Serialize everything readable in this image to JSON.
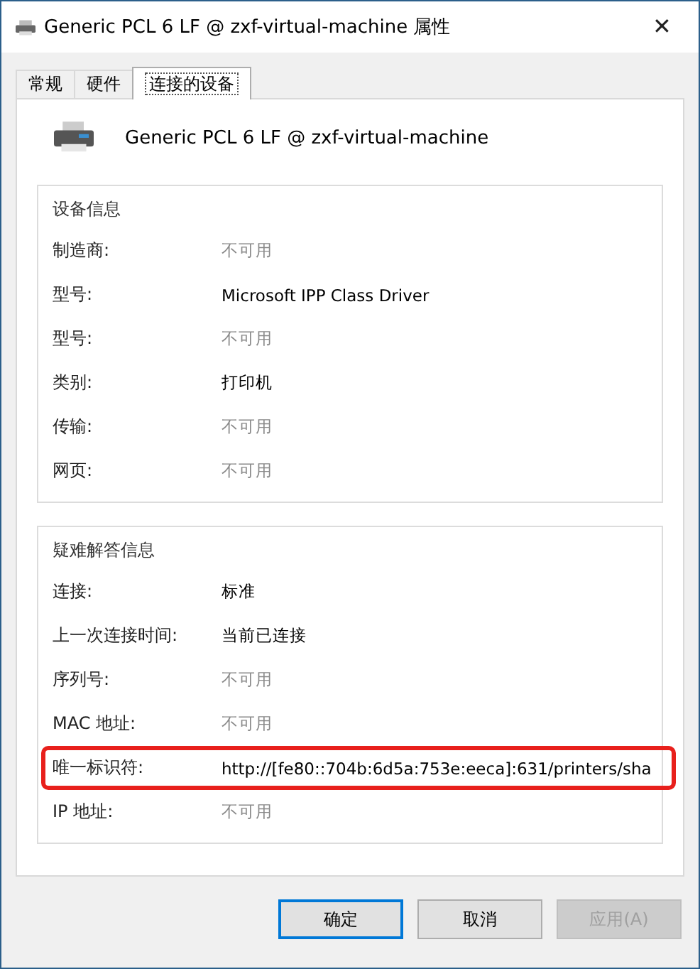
{
  "window": {
    "title": "Generic PCL 6 LF @ zxf-virtual-machine 属性",
    "close": "✕"
  },
  "tabs": [
    {
      "label": "常规",
      "selected": false
    },
    {
      "label": "硬件",
      "selected": false
    },
    {
      "label": "连接的设备",
      "selected": true
    }
  ],
  "device_name": "Generic PCL 6 LF @ zxf-virtual-machine",
  "groups": [
    {
      "title": "设备信息",
      "rows": [
        {
          "label": "制造商:",
          "value": "不可用",
          "disabled": true,
          "highlighted": false
        },
        {
          "label": "型号:",
          "value": "Microsoft IPP Class Driver",
          "disabled": false,
          "highlighted": false
        },
        {
          "label": "型号:",
          "value": "不可用",
          "disabled": true,
          "highlighted": false
        },
        {
          "label": "类别:",
          "value": "打印机",
          "disabled": false,
          "highlighted": false
        },
        {
          "label": "传输:",
          "value": "不可用",
          "disabled": true,
          "highlighted": false
        },
        {
          "label": "网页:",
          "value": "不可用",
          "disabled": true,
          "highlighted": false
        }
      ]
    },
    {
      "title": "疑难解答信息",
      "rows": [
        {
          "label": "连接:",
          "value": "标准",
          "disabled": false,
          "highlighted": false
        },
        {
          "label": "上一次连接时间:",
          "value": "当前已连接",
          "disabled": false,
          "highlighted": false
        },
        {
          "label": "序列号:",
          "value": "不可用",
          "disabled": true,
          "highlighted": false
        },
        {
          "label": "MAC 地址:",
          "value": "不可用",
          "disabled": true,
          "highlighted": false
        },
        {
          "label": "唯一标识符:",
          "value": "http://[fe80::704b:6d5a:753e:eeca]:631/printers/sha",
          "disabled": false,
          "highlighted": true
        },
        {
          "label": "IP 地址:",
          "value": "不可用",
          "disabled": true,
          "highlighted": false
        }
      ]
    }
  ],
  "buttons": [
    {
      "label": "确定",
      "default": true,
      "disabled": false
    },
    {
      "label": "取消",
      "default": false,
      "disabled": false
    },
    {
      "label": "应用(A)",
      "default": false,
      "disabled": true
    }
  ]
}
